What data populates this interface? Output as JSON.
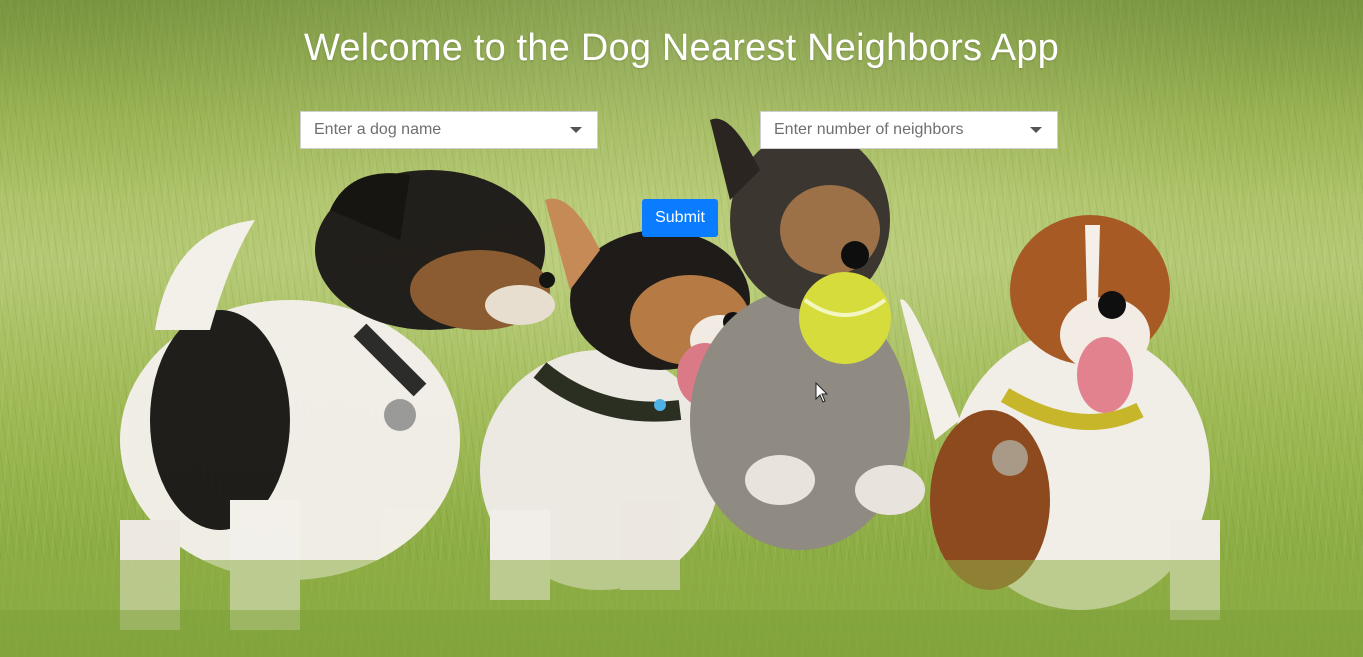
{
  "page": {
    "title": "Welcome to the Dog Nearest Neighbors App"
  },
  "form": {
    "dog_select": {
      "placeholder": "Enter a dog name"
    },
    "neighbors_select": {
      "placeholder": "Enter number of neighbors"
    },
    "submit_label": "Submit"
  },
  "colors": {
    "submit_button": "#0a7cff",
    "title_text": "#ffffff",
    "dropdown_bg": "#ffffff"
  },
  "icons": {
    "dropdown_caret": "chevron-down-icon",
    "pointer": "mouse-cursor-icon"
  }
}
